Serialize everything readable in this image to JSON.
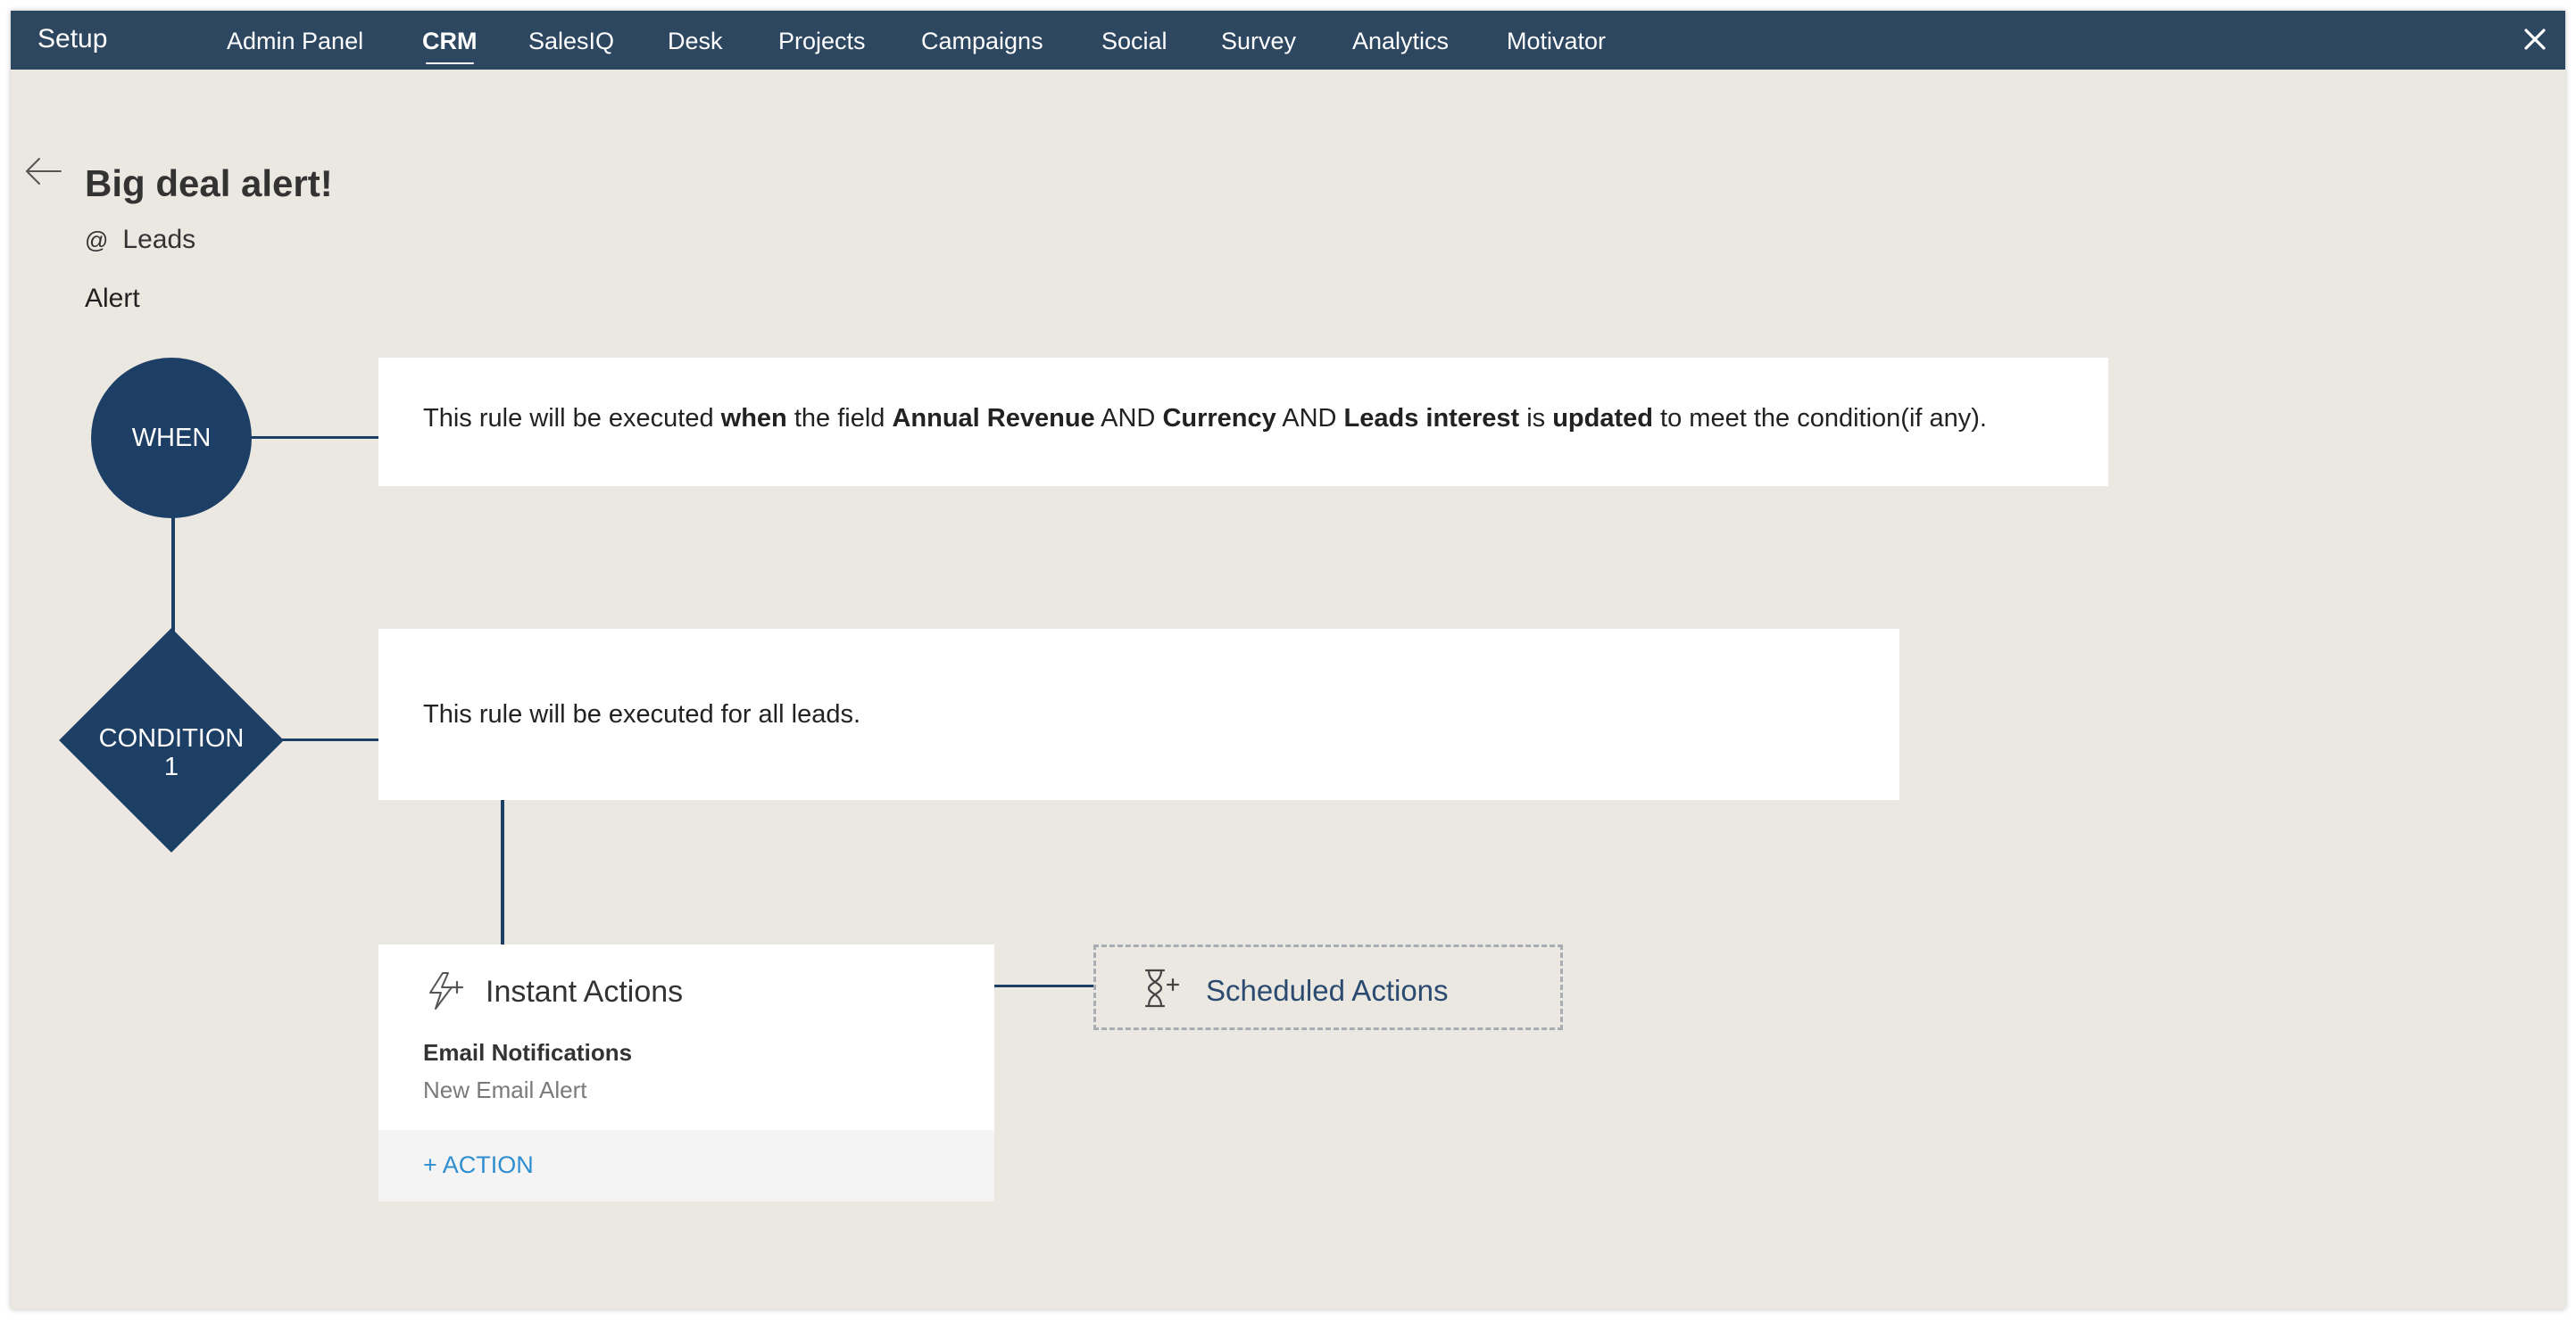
{
  "app": {
    "brand": "Setup"
  },
  "nav": {
    "items": [
      {
        "label": "Admin Panel",
        "active": false
      },
      {
        "label": "CRM",
        "active": true
      },
      {
        "label": "SalesIQ",
        "active": false
      },
      {
        "label": "Desk",
        "active": false
      },
      {
        "label": "Projects",
        "active": false
      },
      {
        "label": "Campaigns",
        "active": false
      },
      {
        "label": "Social",
        "active": false
      },
      {
        "label": "Survey",
        "active": false
      },
      {
        "label": "Analytics",
        "active": false
      },
      {
        "label": "Motivator",
        "active": false
      }
    ]
  },
  "rule": {
    "title": "Big deal alert!",
    "module_prefix": "@",
    "module": "Leads",
    "type": "Alert"
  },
  "when": {
    "node_label": "WHEN",
    "text_1": "This rule will be executed ",
    "bold_when": "when",
    "text_2": " the field ",
    "field_1": "Annual Revenue",
    "and_1": " AND ",
    "field_2": "Currency",
    "and_2": " AND ",
    "field_3": "Leads interest",
    "text_3": " is ",
    "bold_updated": "updated",
    "text_4": " to meet the condition(if any)."
  },
  "condition": {
    "node_label_line1": "CONDITION",
    "node_label_line2": "1",
    "text": "This rule will be executed for all leads."
  },
  "instant_actions": {
    "heading": "Instant Actions",
    "action_title": "Email Notifications",
    "action_sub": "New Email Alert",
    "add_action": "+ ACTION",
    "icon": "lightning-plus-icon"
  },
  "scheduled_actions": {
    "label": "Scheduled Actions",
    "icon": "hourglass-plus-icon"
  },
  "colors": {
    "topbar": "#2e4760",
    "node": "#1d3f66",
    "background": "#ebe8e2",
    "link": "#2f8ed0"
  }
}
